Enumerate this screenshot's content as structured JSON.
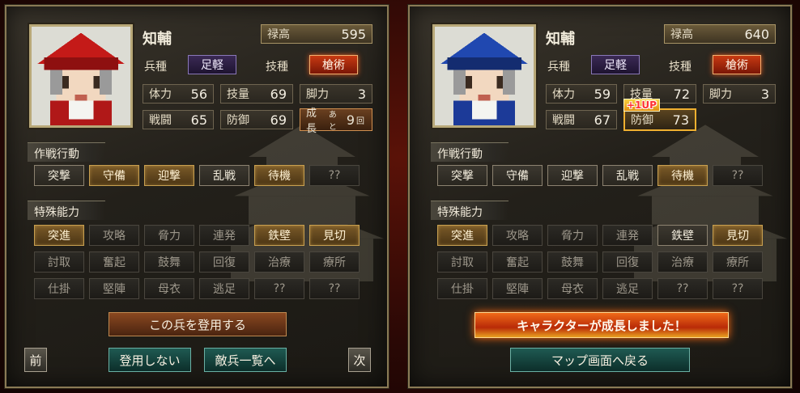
{
  "colors": {
    "accent_gold": "#c8a050",
    "skill_red": "#c83a12",
    "troop_purple": "#3b2a55",
    "teal_button": "#1f5a52",
    "growth_banner": "#f06a18"
  },
  "left": {
    "name": "知輔",
    "salary": {
      "label": "禄高",
      "value": "595"
    },
    "troop_type": {
      "label": "兵種",
      "value": "足軽"
    },
    "skill_type": {
      "label": "技種",
      "value": "槍術"
    },
    "stats": [
      {
        "label": "体力",
        "value": "56"
      },
      {
        "label": "技量",
        "value": "69"
      },
      {
        "label": "脚力",
        "value": "3"
      },
      {
        "label": "戦闘",
        "value": "65"
      },
      {
        "label": "防御",
        "value": "69"
      }
    ],
    "growth": {
      "prefix": "成長",
      "small": "あと",
      "value": "9",
      "suffix": "回"
    },
    "tactics_title": "作戦行動",
    "tactics": [
      "突撃",
      "守備",
      "迎撃",
      "乱戦",
      "待機",
      "??"
    ],
    "abilities_title": "特殊能力",
    "abilities": [
      "突進",
      "攻略",
      "脅力",
      "連発",
      "鉄壁",
      "見切",
      "討取",
      "奮起",
      "鼓舞",
      "回復",
      "治療",
      "療所",
      "仕掛",
      "堅陣",
      "母衣",
      "逃足",
      "??",
      "??"
    ],
    "recruit_button": "この兵を登用する",
    "prev_button": "前",
    "no_recruit_button": "登用しない",
    "enemy_list_button": "敵兵一覧へ",
    "next_button": "次"
  },
  "right": {
    "name": "知輔",
    "salary": {
      "label": "禄高",
      "value": "640"
    },
    "troop_type": {
      "label": "兵種",
      "value": "足軽"
    },
    "skill_type": {
      "label": "技種",
      "value": "槍術"
    },
    "stats": [
      {
        "label": "体力",
        "value": "59"
      },
      {
        "label": "技量",
        "value": "72"
      },
      {
        "label": "脚力",
        "value": "3"
      },
      {
        "label": "戦闘",
        "value": "67"
      },
      {
        "label": "防御",
        "value": "73"
      }
    ],
    "levelup_badge": "+1UP",
    "tactics_title": "作戦行動",
    "tactics": [
      "突撃",
      "守備",
      "迎撃",
      "乱戦",
      "待機",
      "??"
    ],
    "abilities_title": "特殊能力",
    "abilities": [
      "突進",
      "攻略",
      "脅力",
      "連発",
      "鉄壁",
      "見切",
      "討取",
      "奮起",
      "鼓舞",
      "回復",
      "治療",
      "療所",
      "仕掛",
      "堅陣",
      "母衣",
      "逃足",
      "??",
      "??"
    ],
    "growth_message": "キャラクターが成長しました！",
    "return_button": "マップ画面へ戻る"
  }
}
